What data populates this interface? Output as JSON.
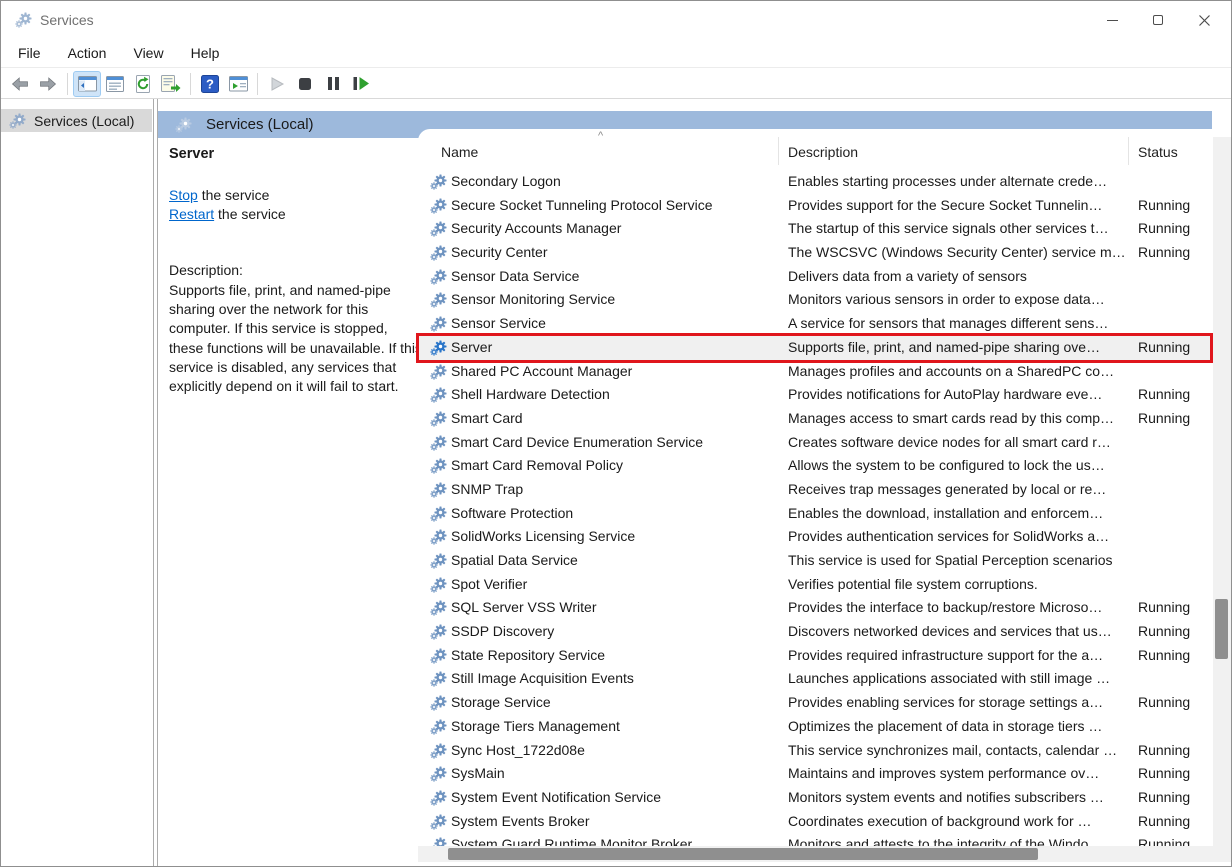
{
  "window": {
    "title": "Services"
  },
  "menu": {
    "items": [
      "File",
      "Action",
      "View",
      "Help"
    ]
  },
  "toolbar": {
    "icons": [
      "back-arrow",
      "forward-arrow",
      "show-console-tree",
      "properties",
      "refresh",
      "export-list",
      "help",
      "show-extended-view",
      "start-service",
      "stop-service",
      "pause-service",
      "restart-service"
    ]
  },
  "tree": {
    "root_label": "Services (Local)"
  },
  "banner": {
    "title": "Services (Local)"
  },
  "detail": {
    "service_name": "Server",
    "stop": {
      "link": "Stop",
      "suffix": " the service"
    },
    "restart": {
      "link": "Restart",
      "suffix": " the service"
    },
    "description_label": "Description:",
    "description": "Supports file, print, and named-pipe sharing over the network for this computer. If this service is stopped, these functions will be unavailable. If this service is disabled, any services that explicitly depend on it will fail to start."
  },
  "list": {
    "columns": [
      "Name",
      "Description",
      "Status"
    ],
    "sort_indicator": "^",
    "rows": [
      {
        "name": "Secondary Logon",
        "description": "Enables starting processes under alternate crede…",
        "status": ""
      },
      {
        "name": "Secure Socket Tunneling Protocol Service",
        "description": "Provides support for the Secure Socket Tunnelin…",
        "status": "Running"
      },
      {
        "name": "Security Accounts Manager",
        "description": "The startup of this service signals other services t…",
        "status": "Running"
      },
      {
        "name": "Security Center",
        "description": "The WSCSVC (Windows Security Center) service m…",
        "status": "Running"
      },
      {
        "name": "Sensor Data Service",
        "description": "Delivers data from a variety of sensors",
        "status": ""
      },
      {
        "name": "Sensor Monitoring Service",
        "description": "Monitors various sensors in order to expose data…",
        "status": ""
      },
      {
        "name": "Sensor Service",
        "description": "A service for sensors that manages different sens…",
        "status": ""
      },
      {
        "name": "Server",
        "description": "Supports file, print, and named-pipe sharing ove…",
        "status": "Running",
        "selected": true
      },
      {
        "name": "Shared PC Account Manager",
        "description": "Manages profiles and accounts on a SharedPC co…",
        "status": ""
      },
      {
        "name": "Shell Hardware Detection",
        "description": "Provides notifications for AutoPlay hardware eve…",
        "status": "Running"
      },
      {
        "name": "Smart Card",
        "description": "Manages access to smart cards read by this comp…",
        "status": "Running"
      },
      {
        "name": "Smart Card Device Enumeration Service",
        "description": "Creates software device nodes for all smart card r…",
        "status": ""
      },
      {
        "name": "Smart Card Removal Policy",
        "description": "Allows the system to be configured to lock the us…",
        "status": ""
      },
      {
        "name": "SNMP Trap",
        "description": "Receives trap messages generated by local or re…",
        "status": ""
      },
      {
        "name": "Software Protection",
        "description": "Enables the download, installation and enforcem…",
        "status": ""
      },
      {
        "name": "SolidWorks Licensing Service",
        "description": "Provides authentication services for SolidWorks a…",
        "status": ""
      },
      {
        "name": "Spatial Data Service",
        "description": "This service is used for Spatial Perception scenarios",
        "status": ""
      },
      {
        "name": "Spot Verifier",
        "description": "Verifies potential file system corruptions.",
        "status": ""
      },
      {
        "name": "SQL Server VSS Writer",
        "description": "Provides the interface to backup/restore Microso…",
        "status": "Running"
      },
      {
        "name": "SSDP Discovery",
        "description": "Discovers networked devices and services that us…",
        "status": "Running"
      },
      {
        "name": "State Repository Service",
        "description": "Provides required infrastructure support for the a…",
        "status": "Running"
      },
      {
        "name": "Still Image Acquisition Events",
        "description": "Launches applications associated with still image …",
        "status": ""
      },
      {
        "name": "Storage Service",
        "description": "Provides enabling services for storage settings a…",
        "status": "Running"
      },
      {
        "name": "Storage Tiers Management",
        "description": "Optimizes the placement of data in storage tiers …",
        "status": ""
      },
      {
        "name": "Sync Host_1722d08e",
        "description": "This service synchronizes mail, contacts, calendar …",
        "status": "Running"
      },
      {
        "name": "SysMain",
        "description": "Maintains and improves system performance ov…",
        "status": "Running"
      },
      {
        "name": "System Event Notification Service",
        "description": "Monitors system events and notifies subscribers …",
        "status": "Running"
      },
      {
        "name": "System Events Broker",
        "description": "Coordinates execution of background work for …",
        "status": "Running"
      },
      {
        "name": "System Guard Runtime Monitor Broker",
        "description": "Monitors and attests to the integrity of the Windo…",
        "status": "Running"
      }
    ]
  },
  "colors": {
    "banner_blue": "#9db9dc",
    "selection_gray": "#f0f0f0",
    "highlight_red": "#e0161c",
    "link_blue": "#0066cc"
  }
}
